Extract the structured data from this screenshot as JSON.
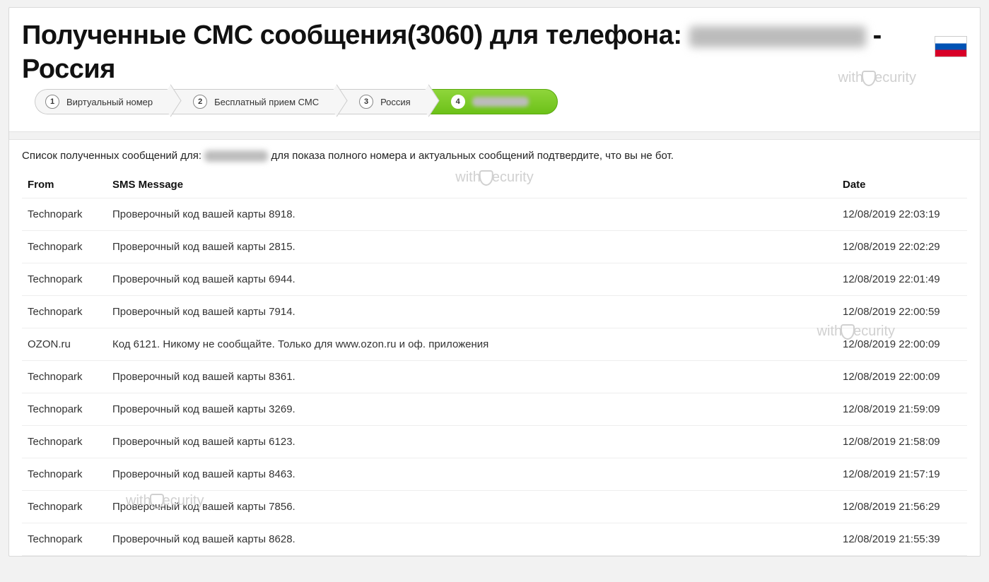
{
  "header": {
    "title_prefix": "Полученные СМС сообщения(",
    "count": "3060",
    "title_mid": ") для телефона: ",
    "title_suffix": " - Россия"
  },
  "watermark": {
    "prefix": "with",
    "suffix": "ecurity"
  },
  "breadcrumb": [
    {
      "num": "1",
      "label": "Виртуальный номер",
      "active": false
    },
    {
      "num": "2",
      "label": "Бесплатный прием СМС",
      "active": false
    },
    {
      "num": "3",
      "label": "Россия",
      "active": false
    },
    {
      "num": "4",
      "label": "",
      "active": true,
      "blurred": true
    }
  ],
  "table": {
    "caption_prefix": "Список полученных сообщений для: ",
    "caption_suffix": " для показа полного номера и актуальных сообщений подтвердите, что вы не бот.",
    "headers": {
      "from": "From",
      "msg": "SMS Message",
      "date": "Date"
    },
    "rows": [
      {
        "from": "Technopark",
        "msg": "Проверочный код вашей карты 8918.",
        "date": "12/08/2019 22:03:19"
      },
      {
        "from": "Technopark",
        "msg": "Проверочный код вашей карты 2815.",
        "date": "12/08/2019 22:02:29"
      },
      {
        "from": "Technopark",
        "msg": "Проверочный код вашей карты 6944.",
        "date": "12/08/2019 22:01:49"
      },
      {
        "from": "Technopark",
        "msg": "Проверочный код вашей карты 7914.",
        "date": "12/08/2019 22:00:59"
      },
      {
        "from": "OZON.ru",
        "msg": "Код 6121. Никому не сообщайте. Только для www.ozon.ru и оф. приложения",
        "date": "12/08/2019 22:00:09"
      },
      {
        "from": "Technopark",
        "msg": "Проверочный код вашей карты 8361.",
        "date": "12/08/2019 22:00:09"
      },
      {
        "from": "Technopark",
        "msg": "Проверочный код вашей карты 3269.",
        "date": "12/08/2019 21:59:09"
      },
      {
        "from": "Technopark",
        "msg": "Проверочный код вашей карты 6123.",
        "date": "12/08/2019 21:58:09"
      },
      {
        "from": "Technopark",
        "msg": "Проверочный код вашей карты 8463.",
        "date": "12/08/2019 21:57:19"
      },
      {
        "from": "Technopark",
        "msg": "Проверочный код вашей карты 7856.",
        "date": "12/08/2019 21:56:29"
      },
      {
        "from": "Technopark",
        "msg": "Проверочный код вашей карты 8628.",
        "date": "12/08/2019 21:55:39"
      }
    ]
  }
}
